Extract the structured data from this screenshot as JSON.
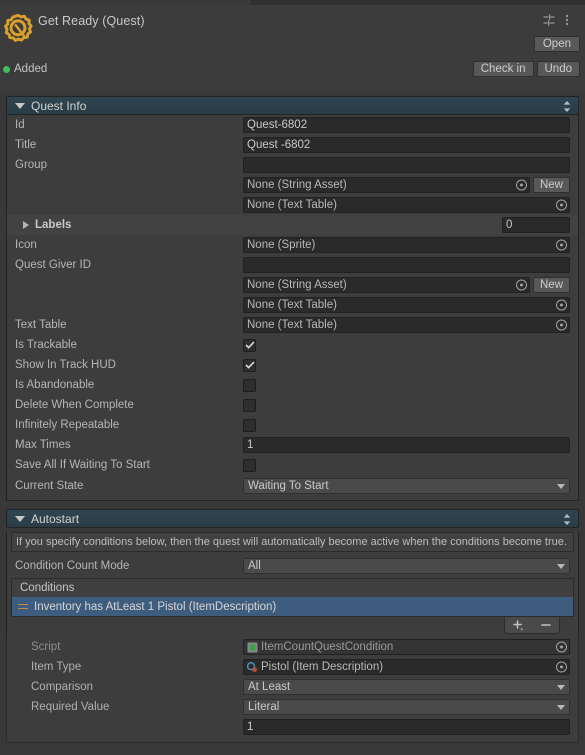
{
  "header": {
    "object_icon": "quest-gear-q-icon",
    "title": "Get Ready (Quest)",
    "settings_icon": "adjustments-icon",
    "menu_icon": "kebab-menu-icon",
    "open_label": "Open",
    "vcs_status": "Added",
    "checkin_label": "Check in",
    "undo_label": "Undo"
  },
  "quest_info": {
    "section_title": "Quest Info",
    "rows": {
      "id": {
        "label": "Id",
        "value": "Quest-6802"
      },
      "title": {
        "label": "Title",
        "value": "Quest -6802"
      },
      "group": {
        "label": "Group",
        "value": ""
      },
      "group_string_asset": {
        "value": "None (String Asset)",
        "new_label": "New"
      },
      "group_text_table": {
        "value": "None (Text Table)"
      },
      "labels": {
        "label": "Labels",
        "count": "0"
      },
      "icon": {
        "label": "Icon",
        "value": "None (Sprite)"
      },
      "quest_giver_id": {
        "label": "Quest Giver ID",
        "value": ""
      },
      "giver_string_asset": {
        "value": "None (String Asset)",
        "new_label": "New"
      },
      "giver_text_table": {
        "value": "None (Text Table)"
      },
      "text_table": {
        "label": "Text Table",
        "value": "None (Text Table)"
      },
      "is_trackable": {
        "label": "Is Trackable",
        "checked": true
      },
      "show_in_track_hud": {
        "label": "Show In Track HUD",
        "checked": true
      },
      "is_abandonable": {
        "label": "Is Abandonable",
        "checked": false
      },
      "delete_when_complete": {
        "label": "Delete When Complete",
        "checked": false
      },
      "infinitely_repeatable": {
        "label": "Infinitely Repeatable",
        "checked": false
      },
      "max_times": {
        "label": "Max Times",
        "value": "1"
      },
      "save_all_if_waiting": {
        "label": "Save All If Waiting To Start",
        "checked": false
      },
      "current_state": {
        "label": "Current State",
        "value": "Waiting To Start"
      }
    }
  },
  "autostart": {
    "section_title": "Autostart",
    "help_text": "If you specify conditions below, then the quest will automatically become active when the conditions become true.",
    "condition_count_mode": {
      "label": "Condition Count Mode",
      "value": "All"
    },
    "conditions_header": "Conditions",
    "conditions": [
      {
        "text": "Inventory has AtLeast 1 Pistol (ItemDescription)",
        "selected": true
      }
    ],
    "add_icon": "plus-icon",
    "remove_icon": "minus-icon",
    "element": {
      "script": {
        "label": "Script",
        "value": "ItemCountQuestCondition",
        "icon": "cs-script-icon"
      },
      "item_type": {
        "label": "Item Type",
        "value": "Pistol (Item Description)",
        "icon": "scriptable-object-icon"
      },
      "comparison": {
        "label": "Comparison",
        "value": "At Least"
      },
      "required_value": {
        "label": "Required Value",
        "value": "Literal"
      },
      "required_literal": {
        "value": "1"
      }
    }
  },
  "colors": {
    "section_header": "#2f4550",
    "selection": "#3e5c7e",
    "accent_gold": "#d9a12c",
    "status_green": "#3fbf5a"
  }
}
